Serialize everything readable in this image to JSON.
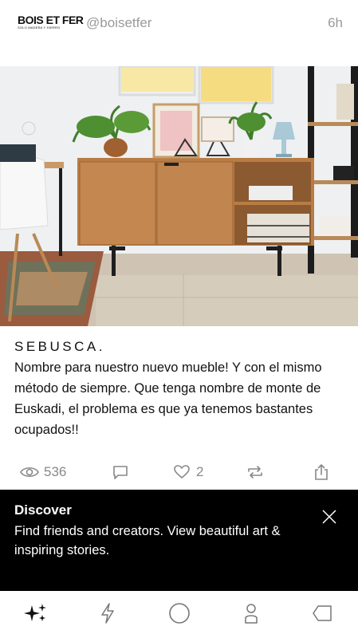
{
  "header": {
    "logo_text": "BOIS ET FER",
    "logo_tagline": "SOLO MADERA Y HIERRO",
    "handle": "@boisetfer",
    "time": "6h"
  },
  "post": {
    "title": "SEBUSCA.",
    "body": "Nombre para nuestro nuevo mueble! Y con el mismo método de siempre. Que tenga nombre de monte de Euskadi, el problema es que ya tenemos bastantes ocupados!!"
  },
  "actions": {
    "views": "536",
    "likes": "2",
    "icons": [
      "eye-icon",
      "comment-icon",
      "heart-icon",
      "repost-icon",
      "share-icon"
    ]
  },
  "banner": {
    "title": "Discover",
    "text": "Find friends and creators. View beautiful art & inspiring stories."
  },
  "tabbar": {
    "icons": [
      "discover-sparkle-icon",
      "lightning-icon",
      "home-circle-icon",
      "profile-icon",
      "tag-icon"
    ]
  },
  "colors": {
    "muted": "#9a9a9a",
    "banner_bg": "#000000",
    "wood": "#b97c45"
  }
}
